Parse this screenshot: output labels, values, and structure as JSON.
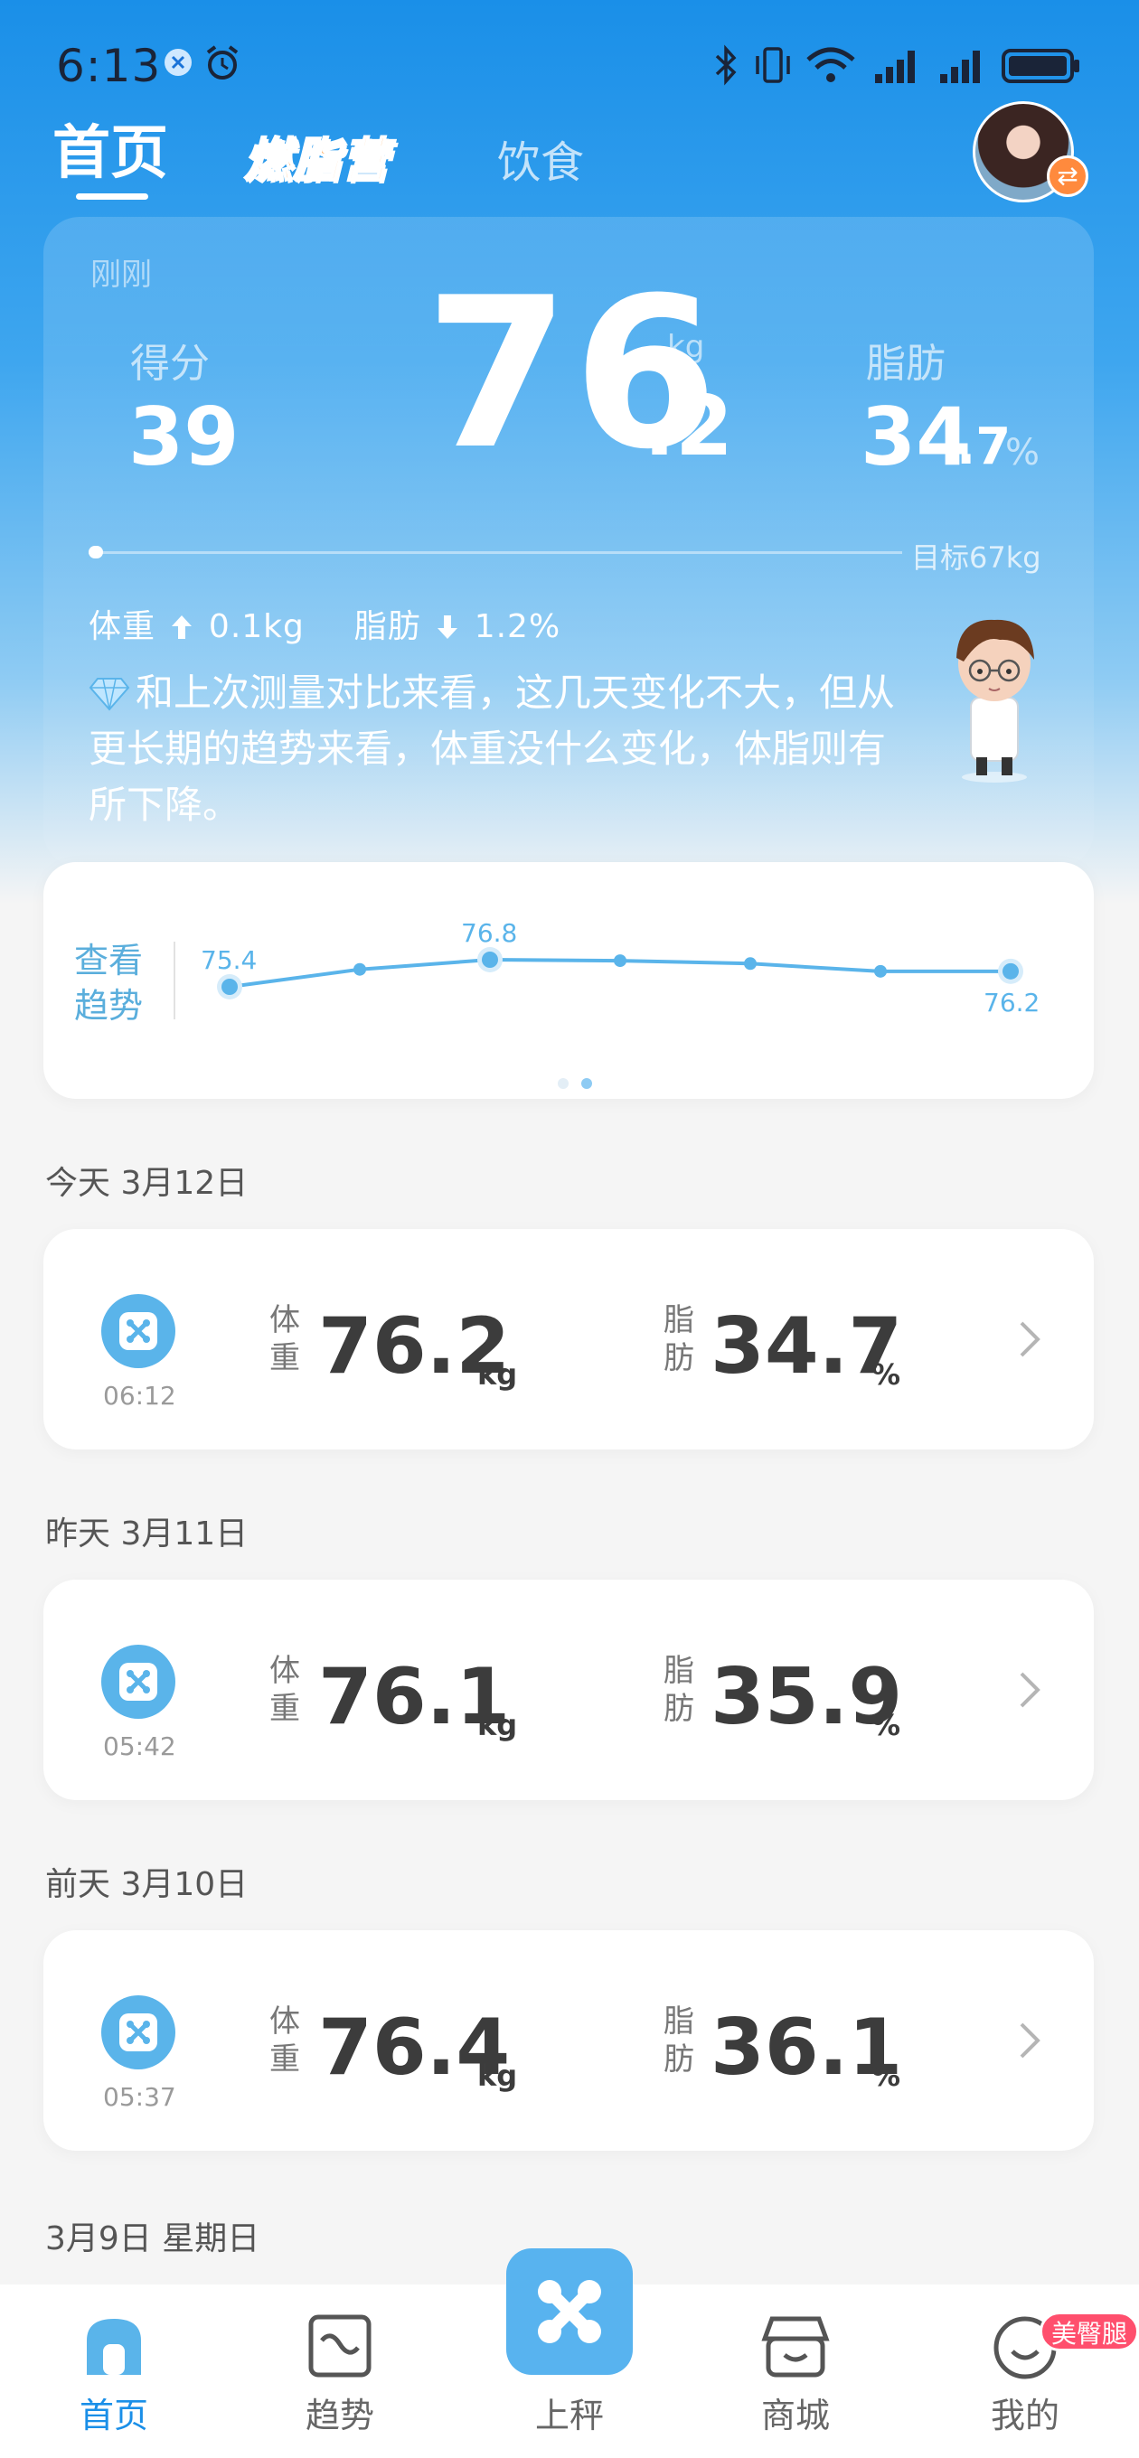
{
  "status_bar": {
    "time": "6:13"
  },
  "tabs": {
    "home": "首页",
    "camp": "燃脂营",
    "diet": "饮食"
  },
  "hero": {
    "measured_time": "刚刚",
    "score_label": "得分",
    "score": "39",
    "weight_int": "76",
    "weight_dec": ".2",
    "weight_unit": "kg",
    "fat_label": "脂肪",
    "fat_int": "34",
    "fat_dec": ".7",
    "fat_unit": "%",
    "goal": "目标67kg",
    "delta_weight_label": "体重",
    "delta_weight": "0.1kg",
    "delta_fat_label": "脂肪",
    "delta_fat": "1.2%",
    "summary": "和上次测量对比来看，这几天变化不大，但从更长期的趋势来看，体重没什么变化，体脂则有所下降。"
  },
  "trend": {
    "title": "查看趋势",
    "label_first": "75.4",
    "label_max": "76.8",
    "label_last": "76.2",
    "chart_data": {
      "type": "line",
      "values": [
        75.4,
        76.3,
        76.8,
        76.75,
        76.6,
        76.2,
        76.2
      ]
    }
  },
  "records": [
    {
      "day": "今天 3月12日",
      "time": "06:12",
      "weight": "76.2",
      "fat": "34.7"
    },
    {
      "day": "昨天 3月11日",
      "time": "05:42",
      "weight": "76.1",
      "fat": "35.9"
    },
    {
      "day": "前天 3月10日",
      "time": "05:37",
      "weight": "76.4",
      "fat": "36.1"
    }
  ],
  "next_day_header": "3月9日  星期日",
  "record_labels": {
    "weight": "体重",
    "fat": "脂肪",
    "kg": "kg",
    "pct": "%"
  },
  "nav": {
    "home": "首页",
    "trend": "趋势",
    "scale": "上秤",
    "mall": "商城",
    "mine": "我的",
    "badge": "美臀腿"
  },
  "colors": {
    "accent": "#1a8fe8",
    "chart_line": "#5ab4ea",
    "badge": "#ff4f6d",
    "camp": "#ff8a1f"
  }
}
